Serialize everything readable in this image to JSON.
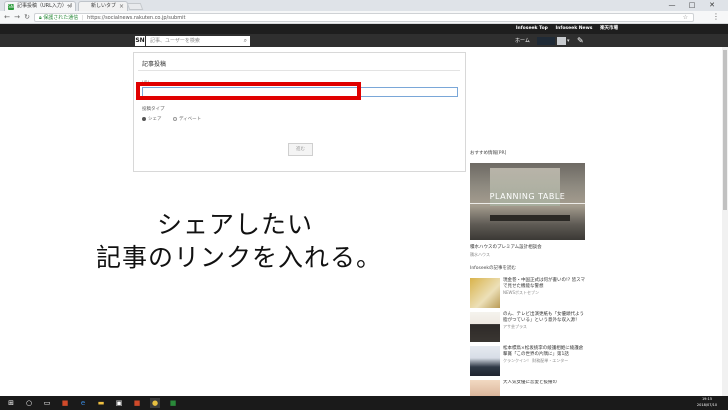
{
  "browser": {
    "tabs": [
      {
        "favicon": "SN",
        "title": "記事投稿（URL入力）- I",
        "active": true
      },
      {
        "title": "新しいタブ",
        "active": false
      }
    ],
    "window_buttons": {
      "minimize": "—",
      "maximize": "□",
      "close": "✕"
    },
    "address": {
      "secure_label": "保護された通信",
      "url": "https://socialnews.rakuten.co.jp/submit"
    }
  },
  "site": {
    "top_links": [
      "Infoseek Top",
      "Infoseek News",
      "楽天市場"
    ],
    "logo": "SN",
    "search_placeholder": "記事、ユーザーを検索",
    "home_label": "ホーム"
  },
  "form": {
    "title": "記事投稿",
    "url_label": "URL",
    "url_value": "",
    "type_label": "投稿タイプ",
    "types": [
      {
        "label": "シェア",
        "selected": true
      },
      {
        "label": "ディベート",
        "selected": false
      }
    ],
    "submit_label": "進む"
  },
  "caption": {
    "line1": "シェアしたい",
    "line2": "記事のリンクを入れる。"
  },
  "sidebar": {
    "pr_label": "おすすめ情報[PR]",
    "pr_image_text": "PLANNING TABLE",
    "pr_title": "積水ハウスのプレミアム設計相談会",
    "pr_source": "積水ハウス",
    "related_label": "Infoseekの記事を読む",
    "related": [
      {
        "title": "現金巻・中国正式は何が書いの!? 皆スマで見せた機能な警想",
        "source": "NEWSポストセブン"
      },
      {
        "title": "のん、テレビ出演更紙も「女優頭代よう脂がつている」という意外な収入源！",
        "source": "アサ芸プラス"
      },
      {
        "title": "松本標鳥×松坂挑李の綾護相姫に綾護倉撃賞「この世界の片隅に」第1話",
        "source": "クランクイン！ 財務配単・エンター"
      },
      {
        "title": "大人気女優に恋愛と抜擢の",
        "source": ""
      }
    ]
  },
  "taskbar": {
    "clock_time": "19:15",
    "clock_date": "2018/07/10"
  },
  "colors": {
    "highlight": "#e00000",
    "site_header": "#2f2f2f",
    "secure": "#2a8a3a"
  }
}
